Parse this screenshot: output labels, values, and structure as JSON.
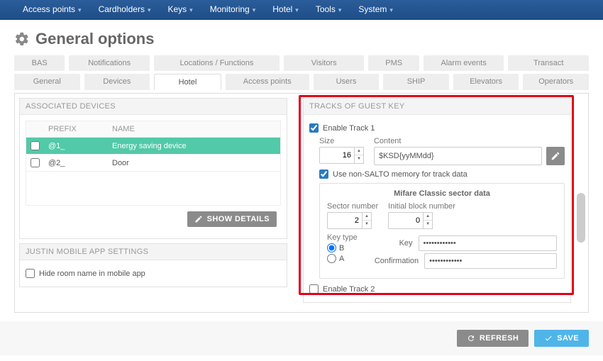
{
  "nav": [
    "Access points",
    "Cardholders",
    "Keys",
    "Monitoring",
    "Hotel",
    "Tools",
    "System"
  ],
  "page_title": "General options",
  "tabs_top": [
    "BAS",
    "Notifications",
    "Locations / Functions",
    "Visitors",
    "PMS",
    "Alarm events",
    "Transact"
  ],
  "tabs_sub": [
    "General",
    "Devices",
    "Hotel",
    "Access points",
    "Users",
    "SHIP",
    "Elevators",
    "Operators"
  ],
  "tabs_sub_active": 2,
  "assoc": {
    "title": "ASSOCIATED DEVICES",
    "headers": {
      "prefix": "PREFIX",
      "name": "NAME"
    },
    "rows": [
      {
        "prefix": "@1_",
        "name": "Energy saving device",
        "selected": true
      },
      {
        "prefix": "@2_",
        "name": "Door",
        "selected": false
      }
    ],
    "show_details": "SHOW DETAILS"
  },
  "justin": {
    "title": "JUSTIN MOBILE APP SETTINGS",
    "hide_room": "Hide room name in mobile app"
  },
  "tracks": {
    "title": "TRACKS OF GUEST KEY",
    "enable1": "Enable Track 1",
    "size_lbl": "Size",
    "size_val": "16",
    "content_lbl": "Content",
    "content_val": "$KSD{yyMMdd}",
    "non_salto": "Use non-SALTO memory for track data",
    "mifare_title": "Mifare Classic sector data",
    "sector_lbl": "Sector number",
    "sector_val": "2",
    "block_lbl": "Initial block number",
    "block_val": "0",
    "keytype_lbl": "Key type",
    "kt_b": "B",
    "kt_a": "A",
    "key_lbl": "Key",
    "key_val": "••••••••••••",
    "conf_lbl": "Confirmation",
    "conf_val": "••••••••••••",
    "enable2": "Enable Track 2"
  },
  "footer": {
    "refresh": "REFRESH",
    "save": "SAVE"
  }
}
